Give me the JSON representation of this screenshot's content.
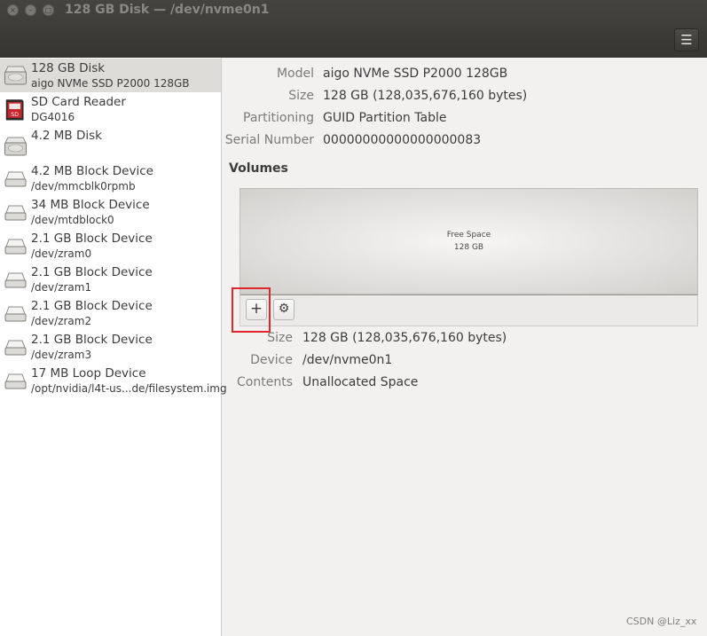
{
  "window": {
    "title": "128 GB Disk — /dev/nvme0n1",
    "close_glyph": "×",
    "minimize_glyph": "–",
    "maximize_glyph": "□",
    "menu_icon": "hamburger-menu-icon",
    "menu_glyph": "☰"
  },
  "sidebar": {
    "devices": [
      {
        "name": "128 GB Disk",
        "sub": "aigo NVMe SSD P2000 128GB",
        "icon": "hard-disk-icon",
        "selected": true
      },
      {
        "name": "SD Card Reader",
        "sub": "DG4016",
        "icon": "sd-card-icon",
        "badge": "SD"
      },
      {
        "name": "4.2 MB Disk",
        "sub": "",
        "icon": "hard-disk-icon"
      },
      {
        "name": "4.2 MB Block Device",
        "sub": "/dev/mmcblk0rpmb",
        "icon": "drive-icon"
      },
      {
        "name": "34 MB Block Device",
        "sub": "/dev/mtdblock0",
        "icon": "drive-icon"
      },
      {
        "name": "2.1 GB Block Device",
        "sub": "/dev/zram0",
        "icon": "drive-icon"
      },
      {
        "name": "2.1 GB Block Device",
        "sub": "/dev/zram1",
        "icon": "drive-icon"
      },
      {
        "name": "2.1 GB Block Device",
        "sub": "/dev/zram2",
        "icon": "drive-icon"
      },
      {
        "name": "2.1 GB Block Device",
        "sub": "/dev/zram3",
        "icon": "drive-icon"
      },
      {
        "name": "17 MB Loop Device",
        "sub": "/opt/nvidia/l4t-us...de/filesystem.img",
        "icon": "drive-icon"
      }
    ]
  },
  "disk": {
    "model_label": "Model",
    "model": "aigo NVMe SSD P2000 128GB",
    "size_label": "Size",
    "size": "128 GB (128,035,676,160 bytes)",
    "partitioning_label": "Partitioning",
    "partitioning": "GUID Partition Table",
    "serial_label": "Serial Number",
    "serial": "00000000000000000083"
  },
  "volumes": {
    "heading": "Volumes",
    "free_space_label": "Free Space",
    "free_space_size": "128 GB",
    "add_glyph": "+",
    "settings_glyph": "⚙",
    "size_label": "Size",
    "size": "128 GB (128,035,676,160 bytes)",
    "device_label": "Device",
    "device": "/dev/nvme0n1",
    "contents_label": "Contents",
    "contents": "Unallocated Space"
  },
  "watermark": "CSDN @Liz_xx",
  "colors": {
    "titlebar": "#3c3b37",
    "selection": "#dedcd9",
    "highlight_box": "#e0262b"
  }
}
